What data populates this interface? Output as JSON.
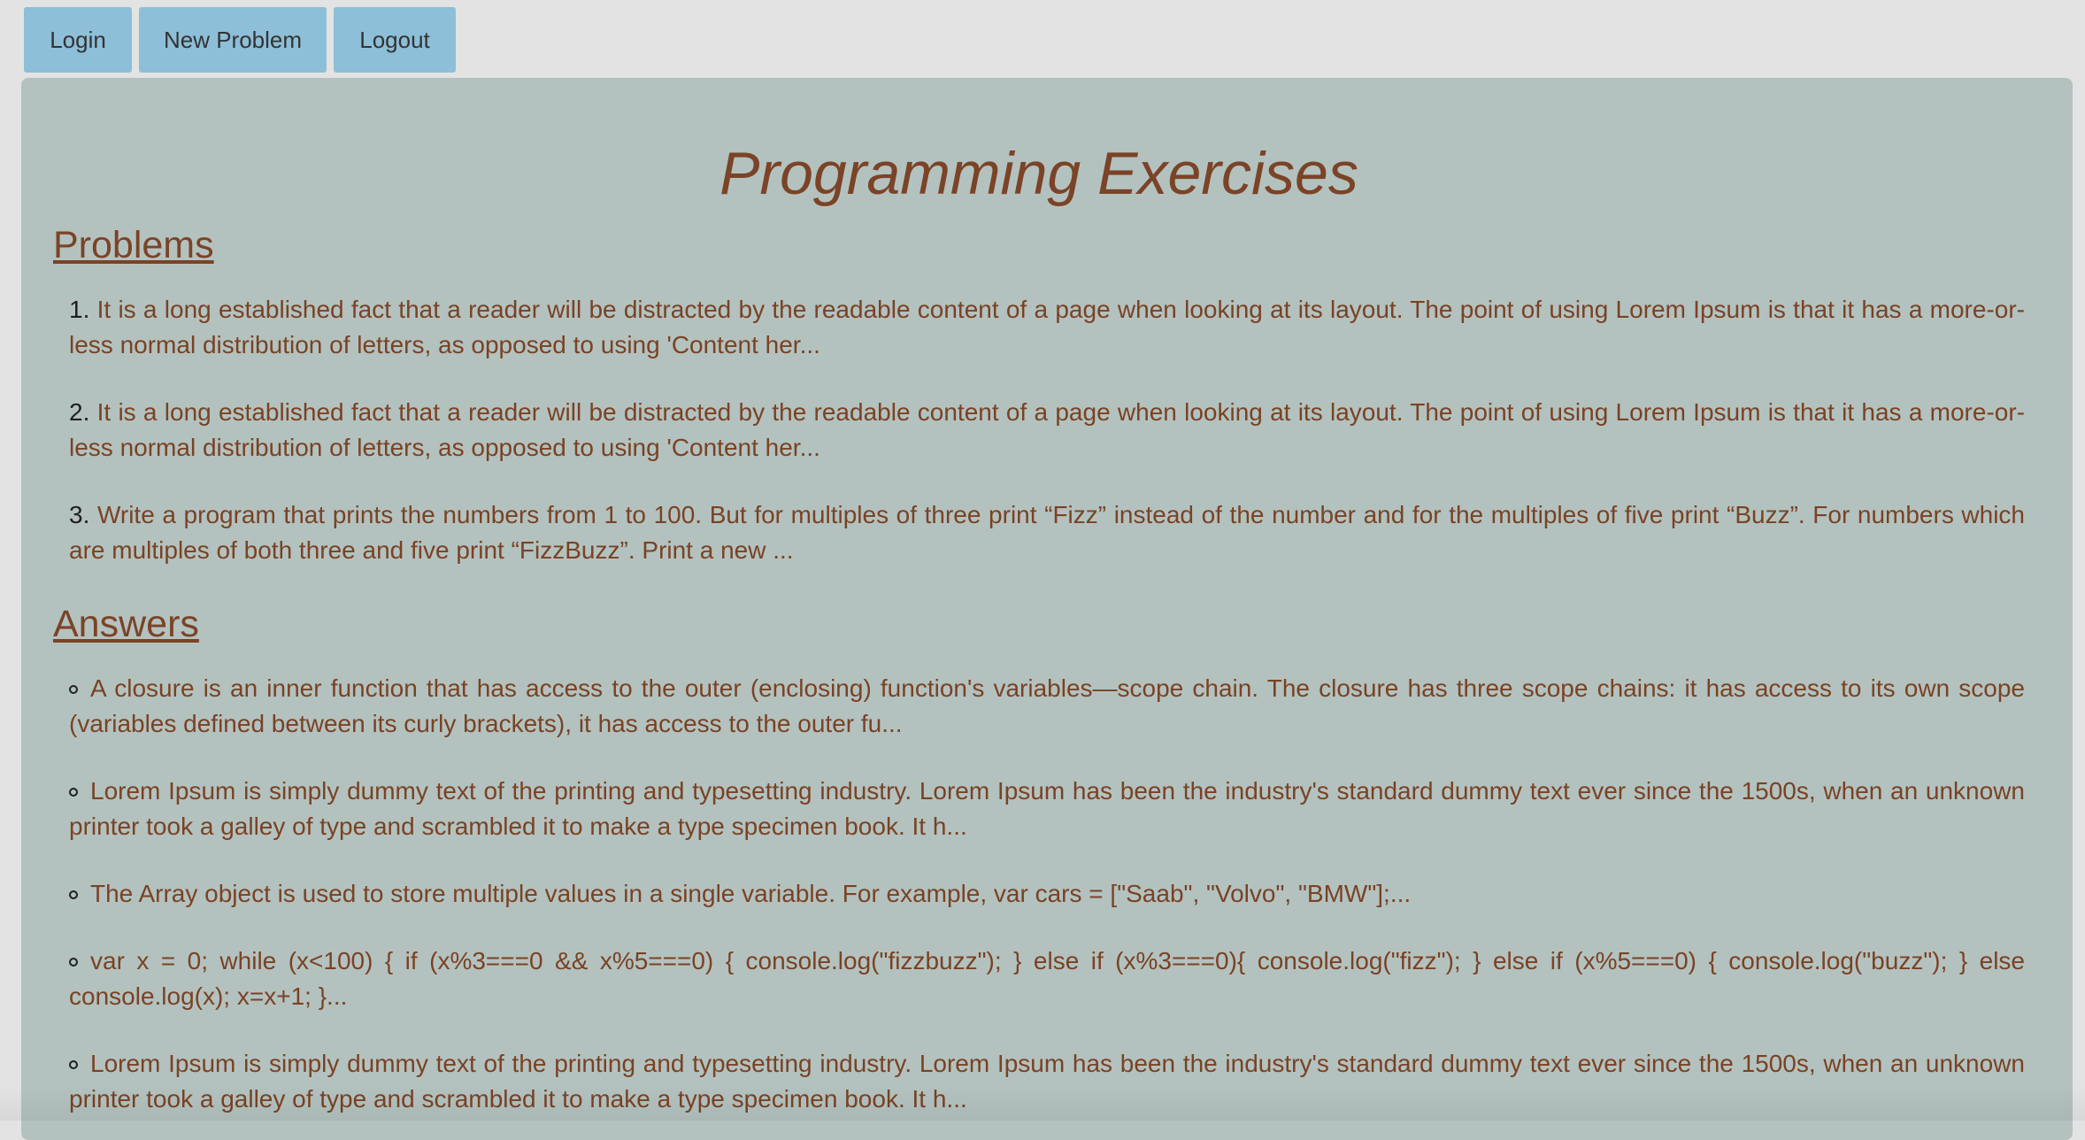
{
  "nav": {
    "login_label": "Login",
    "new_problem_label": "New Problem",
    "logout_label": "Logout"
  },
  "page": {
    "title": "Programming Exercises"
  },
  "problems": {
    "heading": "Problems",
    "items": [
      {
        "number": "1.",
        "text": "It is a long established fact that a reader will be distracted by the readable content of a page when looking at its layout. The point of using Lorem Ipsum is that it has a more-or-less normal distribution of letters, as opposed to using 'Content her..."
      },
      {
        "number": "2.",
        "text": "It is a long established fact that a reader will be distracted by the readable content of a page when looking at its layout. The point of using Lorem Ipsum is that it has a more-or-less normal distribution of letters, as opposed to using 'Content her..."
      },
      {
        "number": "3.",
        "text": "Write a program that prints the numbers from 1 to 100. But for multiples of three print “Fizz” instead of the number and for the multiples of five print “Buzz”. For numbers which are multiples of both three and five print “FizzBuzz”. Print a new ..."
      }
    ]
  },
  "answers": {
    "heading": "Answers",
    "items": [
      {
        "text": "A closure is an inner function that has access to the outer (enclosing) function's variables—scope chain. The closure has three scope chains: it has access to its own scope (variables defined between its curly brackets), it has access to the outer fu..."
      },
      {
        "text": "Lorem Ipsum is simply dummy text of the printing and typesetting industry. Lorem Ipsum has been the industry's standard dummy text ever since the 1500s, when an unknown printer took a galley of type and scrambled it to make a type specimen book. It h..."
      },
      {
        "text": "The Array object is used to store multiple values in a single variable. For example, var cars = [\"Saab\", \"Volvo\", \"BMW\"];..."
      },
      {
        "text": "var x = 0; while (x<100) { if (x%3===0 && x%5===0) { console.log(\"fizzbuzz\"); } else if (x%3===0){ console.log(\"fizz\"); } else if (x%5===0) { console.log(\"buzz\"); } else console.log(x); x=x+1; }..."
      },
      {
        "text": "Lorem Ipsum is simply dummy text of the printing and typesetting industry. Lorem Ipsum has been the industry's standard dummy text ever since the 1500s, when an unknown printer took a galley of type and scrambled it to make a type specimen book. It h..."
      }
    ]
  },
  "colors": {
    "page_background": "#e3e3e3",
    "panel_background": "#b3c2bf",
    "button_background": "#8dbfd8",
    "text_brown": "#7a4224"
  }
}
